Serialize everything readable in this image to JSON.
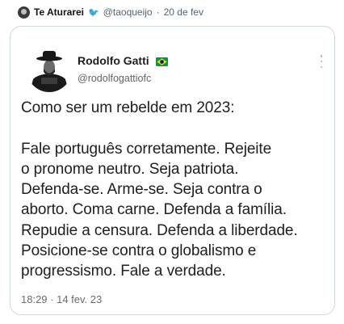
{
  "outer_post": {
    "display_name": "Te Aturarei",
    "verified_icon": "twitter-bird-icon",
    "handle": "@taoqueijo",
    "separator": "·",
    "date": "20 de fev"
  },
  "quoted_post": {
    "author_name": "Rodolfo Gatti",
    "author_flag_icon": "brazil-flag-icon",
    "author_handle": "@rodolfogattiofc",
    "more_icon": "more-vertical-icon",
    "text": "Como ser um rebelde em 2023:\n\nFale português corretamente. Rejeite\no pronome neutro. Seja patriota.\nDefenda-se. Arme-se. Seja contra o\naborto. Coma carne. Defenda a família.\nRepudie a censura. Defenda a liberdade.\nPosicione-se contra o globalismo e\nprogressismo. Fale a verdade.",
    "timestamp": "18:29 · 14 fev. 23"
  },
  "colors": {
    "card_border": "#cfd9de",
    "secondary_text": "#536471",
    "flag_green": "#009b3a",
    "flag_yellow": "#fedf00",
    "flag_blue": "#002776"
  }
}
